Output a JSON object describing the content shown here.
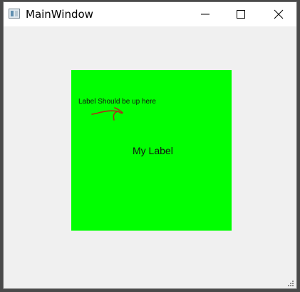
{
  "window": {
    "title": "MainWindow",
    "icon": "app-window-icon"
  },
  "controls": {
    "minimize_icon": "minimize-icon",
    "maximize_icon": "maximize-icon",
    "close_icon": "close-icon"
  },
  "panel": {
    "color": "#00ff00",
    "note_text": "Label Should be up here",
    "annotation": "red-arrow-icon",
    "annotation_color": "#b02a1a",
    "label_text": "My Label"
  },
  "statusbar": {
    "grip_icon": "resize-grip-icon"
  }
}
